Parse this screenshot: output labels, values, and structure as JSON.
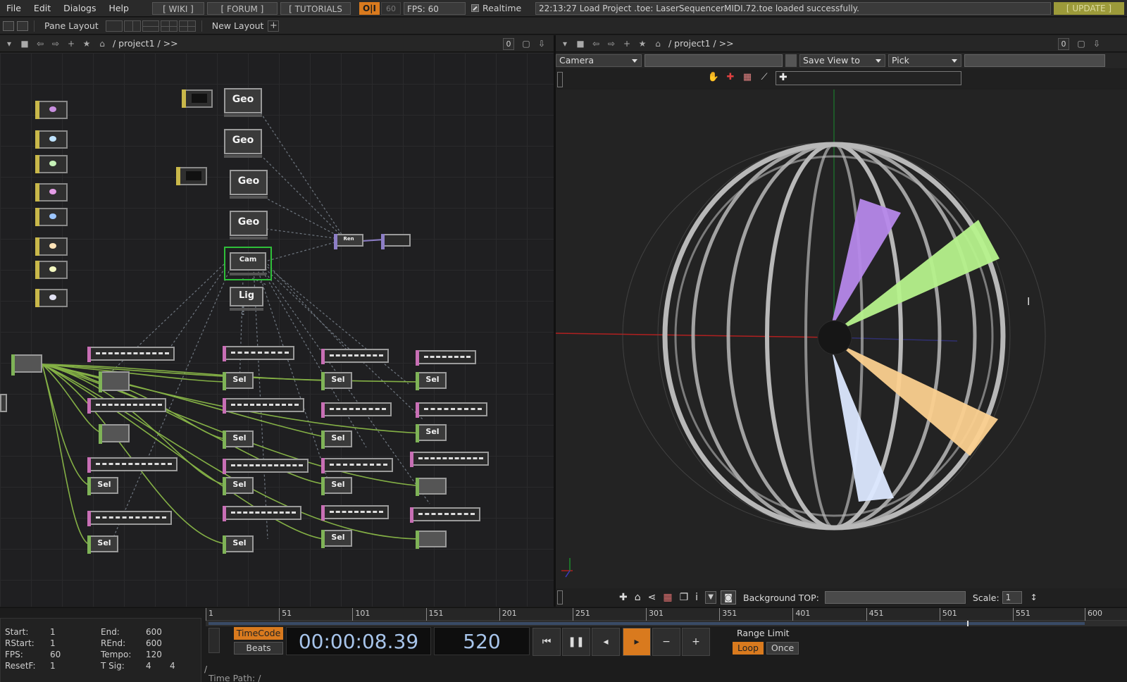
{
  "menubar": {
    "items": [
      "File",
      "Edit",
      "Dialogs",
      "Help"
    ],
    "wiki": "[ WIKI ]",
    "forum": "[ FORUM ]",
    "tutorials": "[ TUTORIALS ]",
    "oi": "O|I",
    "sixty": "60",
    "fps": "FPS:  60",
    "realtime": "Realtime",
    "status": "22:13:27 Load Project .toe: LaserSequencerMIDI.72.toe loaded successfully.",
    "update": "[ UPDATE ]"
  },
  "toolbar2": {
    "pane_layout": "Pane Layout",
    "new_layout": "New Layout"
  },
  "network": {
    "path": "/ project1 / >>",
    "zero": "0",
    "nodes": {
      "geo1": "Geo",
      "geo2": "Geo",
      "geo3": "Geo",
      "geo4": "Geo",
      "cam": "Cam",
      "lig": "Lig",
      "ren": "Ren",
      "sel": "Sel"
    }
  },
  "viewer": {
    "path": "/ project1 / >>",
    "zero": "0",
    "camera": "Camera",
    "save_view": "Save View to",
    "pick": "Pick",
    "background_top": "Background TOP:",
    "scale_label": "Scale:",
    "scale_value": "1"
  },
  "timeline": {
    "ruler_ticks": [
      "1",
      "51",
      "101",
      "151",
      "201",
      "251",
      "301",
      "351",
      "401",
      "451",
      "501",
      "551",
      "600"
    ],
    "start_label": "Start:",
    "start": "1",
    "rstart_label": "RStart:",
    "rstart": "1",
    "fps_label": "FPS:",
    "fps": "60",
    "resetf_label": "ResetF:",
    "resetf": "1",
    "end_label": "End:",
    "end": "600",
    "rend_label": "REnd:",
    "rend": "600",
    "tempo_label": "Tempo:",
    "tempo": "120",
    "tsig_label": "T Sig:",
    "tsig_a": "4",
    "tsig_b": "4",
    "timecode": "TimeCode",
    "beats": "Beats",
    "time_display": "00:00:08.39",
    "frame_display": "520",
    "range_limit": "Range Limit",
    "loop": "Loop",
    "once": "Once",
    "time_path": "Time Path: /",
    "playhead_fraction": 0.866
  },
  "colors": {
    "accent": "#d97a1e",
    "update": "#9c9a3a",
    "wire": "#8fc04a",
    "selected": "#2fbf3a"
  }
}
